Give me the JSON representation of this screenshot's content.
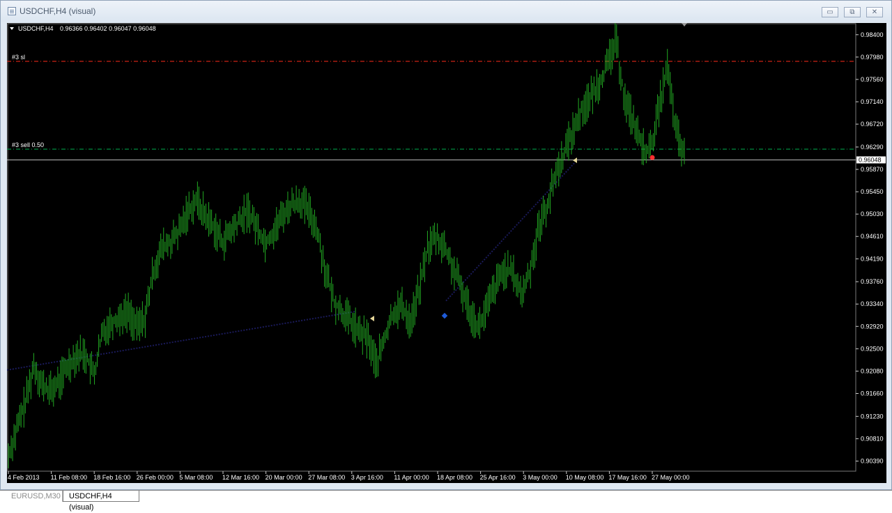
{
  "window": {
    "title": "USDCHF,H4 (visual)",
    "buttons": {
      "minimize": "▭",
      "maximize": "⧉",
      "close": "✕"
    }
  },
  "chart": {
    "symbol_header": "USDCHF,H4",
    "ohlc": "0.96366 0.96402 0.96047 0.96048",
    "price_labels": [
      "0.98400",
      "0.97980",
      "0.97560",
      "0.97140",
      "0.96720",
      "0.96290",
      "0.95870",
      "0.95450",
      "0.95030",
      "0.94610",
      "0.94190",
      "0.93760",
      "0.93340",
      "0.92920",
      "0.92500",
      "0.92080",
      "0.91660",
      "0.91230",
      "0.90810",
      "0.90390"
    ],
    "current_price": "0.96048",
    "time_labels": [
      "4 Feb 2013",
      "11 Feb 08:00",
      "18 Feb 16:00",
      "26 Feb 00:00",
      "5 Mar 08:00",
      "12 Mar 16:00",
      "20 Mar 00:00",
      "27 Mar 08:00",
      "3 Apr 16:00",
      "11 Apr 00:00",
      "18 Apr 08:00",
      "25 Apr 16:00",
      "3 May 00:00",
      "10 May 08:00",
      "17 May 16:00",
      "27 May 00:00"
    ],
    "levels": [
      {
        "label": "#3 sl",
        "price": 0.979,
        "color": "#ff2a1a"
      },
      {
        "label": "#3 sell 0.50",
        "price": 0.9625,
        "color": "#00b050"
      }
    ],
    "colors": {
      "bars": "#22aa22",
      "background": "#000000",
      "grid_text": "#ffffff",
      "trend": "#1a1a5a"
    }
  },
  "chart_data": {
    "type": "bar",
    "title": "USDCHF,H4",
    "ylim": [
      0.902,
      0.9862
    ],
    "x_categories": [
      "4 Feb 2013",
      "11 Feb 08:00",
      "18 Feb 16:00",
      "26 Feb 00:00",
      "5 Mar 08:00",
      "12 Mar 16:00",
      "20 Mar 00:00",
      "27 Mar 08:00",
      "3 Apr 16:00",
      "11 Apr 00:00",
      "18 Apr 08:00",
      "25 Apr 16:00",
      "3 May 00:00",
      "10 May 08:00",
      "17 May 16:00",
      "27 May 00:00"
    ],
    "price_path": [
      0.905,
      0.91,
      0.915,
      0.922,
      0.918,
      0.917,
      0.919,
      0.922,
      0.924,
      0.924,
      0.92,
      0.928,
      0.93,
      0.931,
      0.932,
      0.929,
      0.931,
      0.94,
      0.944,
      0.945,
      0.947,
      0.951,
      0.953,
      0.95,
      0.948,
      0.945,
      0.947,
      0.949,
      0.951,
      0.948,
      0.945,
      0.947,
      0.95,
      0.952,
      0.953,
      0.951,
      0.948,
      0.94,
      0.934,
      0.932,
      0.93,
      0.928,
      0.927,
      0.922,
      0.927,
      0.932,
      0.933,
      0.93,
      0.936,
      0.944,
      0.946,
      0.944,
      0.94,
      0.936,
      0.932,
      0.929,
      0.933,
      0.937,
      0.94,
      0.939,
      0.935,
      0.94,
      0.948,
      0.952,
      0.958,
      0.962,
      0.966,
      0.97,
      0.972,
      0.975,
      0.978,
      0.983,
      0.972,
      0.968,
      0.963,
      0.962,
      0.97,
      0.978,
      0.966,
      0.961
    ],
    "series": [
      {
        "name": "USDCHF,H4",
        "values": []
      }
    ]
  },
  "tabs": [
    {
      "label": "EURUSD,M30",
      "active": false
    },
    {
      "label": "USDCHF,H4 (visual)",
      "active": true
    }
  ]
}
